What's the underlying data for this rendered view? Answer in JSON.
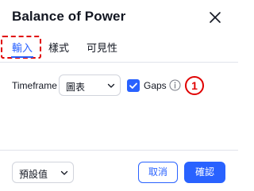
{
  "dialog": {
    "title": "Balance of Power"
  },
  "tabs": [
    {
      "label": "輸入",
      "active": true
    },
    {
      "label": "樣式",
      "active": false
    },
    {
      "label": "可見性",
      "active": false
    }
  ],
  "inputs": {
    "timeframe_label": "Timeframe",
    "timeframe_value": "圖表",
    "gaps_label": "Gaps",
    "gaps_checked": true
  },
  "annotation": {
    "badge": "1"
  },
  "footer": {
    "defaults_label": "預設值",
    "cancel_label": "取消",
    "ok_label": "確認"
  },
  "colors": {
    "accent": "#2962ff",
    "annotation": "#e00000",
    "divider": "#e0e3eb"
  }
}
